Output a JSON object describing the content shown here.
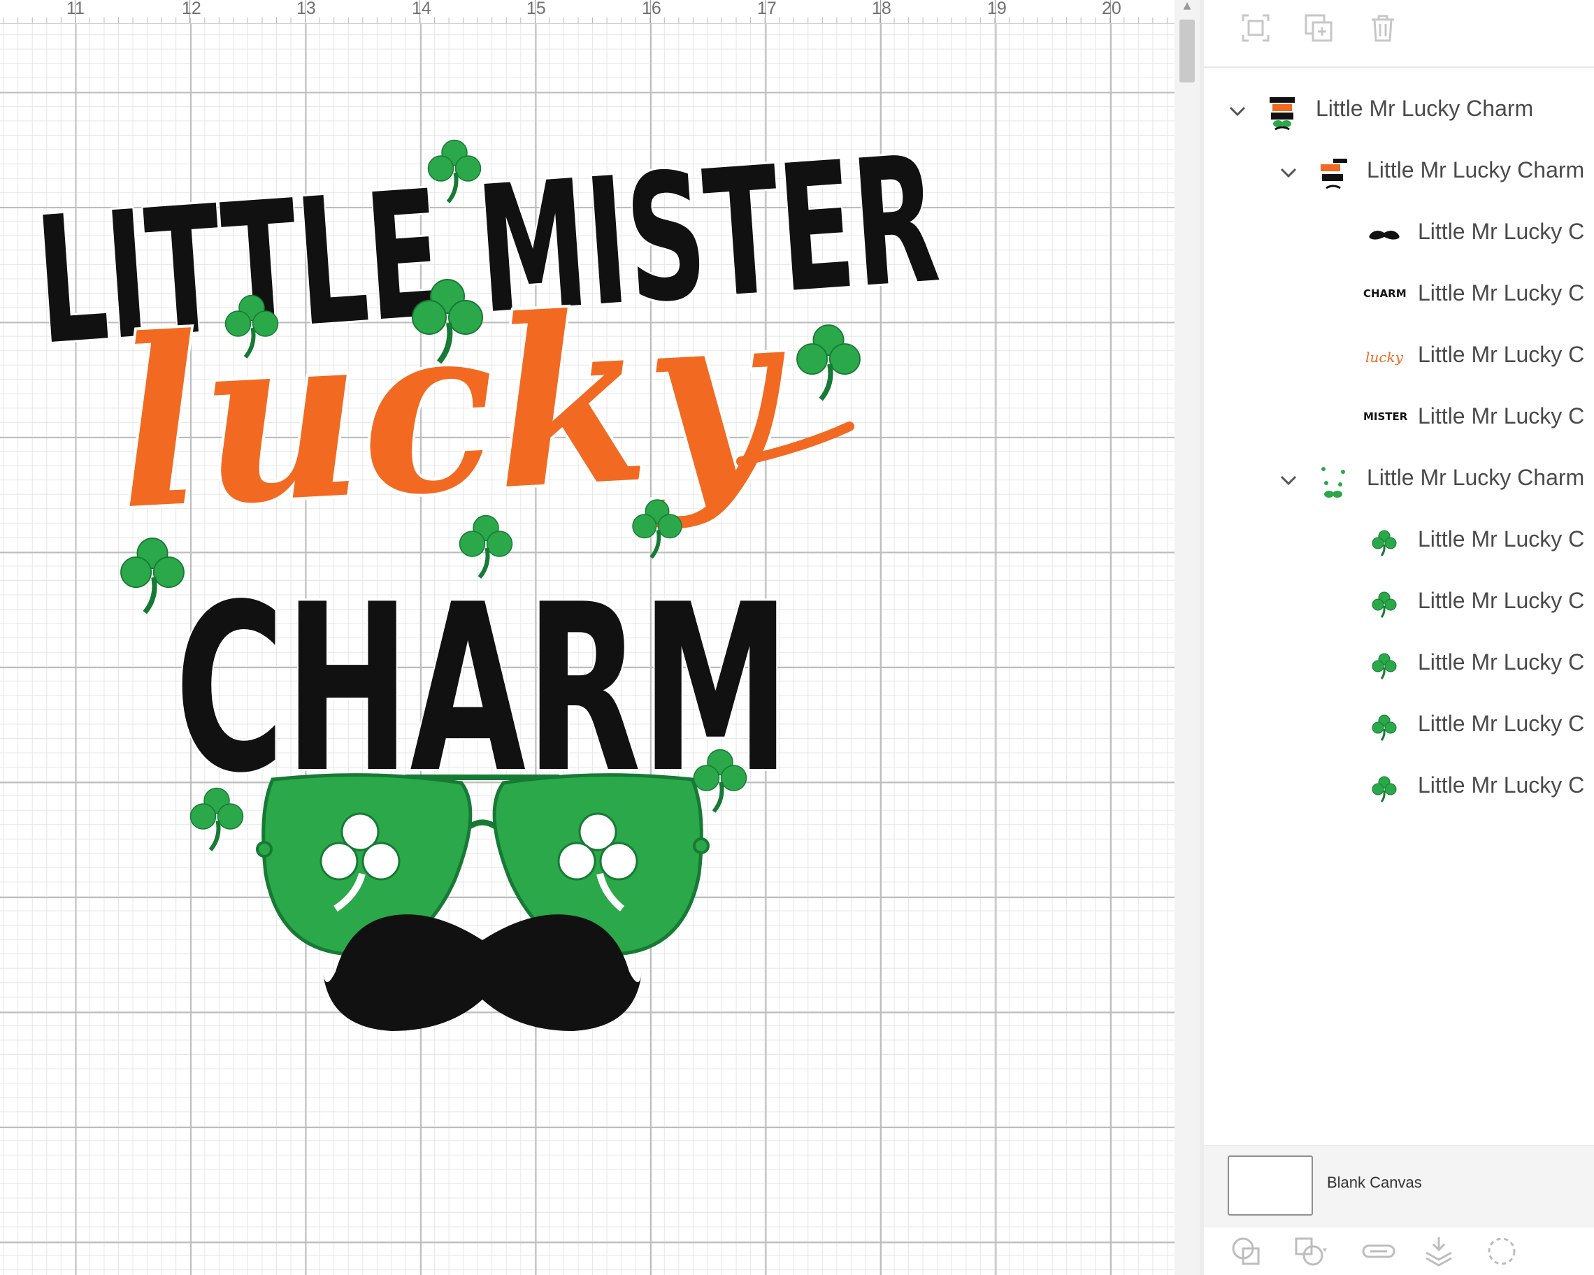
{
  "ruler": {
    "ticks": [
      "11",
      "12",
      "13",
      "14",
      "15",
      "16",
      "17",
      "18",
      "19",
      "20"
    ]
  },
  "design": {
    "line1": "LITTLE MISTER",
    "line2": "lucky",
    "line3": "CHARM",
    "colors": {
      "black": "#111111",
      "orange": "#f26a21",
      "green": "#2aa84a",
      "dark_green": "#177a34"
    }
  },
  "layers": {
    "rows": [
      {
        "label": "Little Mr Lucky Charm",
        "thumb": "full-design-thumb",
        "level": 0,
        "expanded": true
      },
      {
        "label": "Little Mr Lucky Charm",
        "thumb": "text-group-thumb",
        "level": 1,
        "expanded": true
      },
      {
        "label": "Little Mr Lucky C",
        "thumb": "mustache-thumb",
        "level": 2
      },
      {
        "label": "Little Mr Lucky C",
        "thumb": "charm-thumb",
        "level": 2,
        "thumb_text": "CHARM"
      },
      {
        "label": "Little Mr Lucky C",
        "thumb": "lucky-thumb",
        "level": 2,
        "thumb_text": "lucky"
      },
      {
        "label": "Little Mr Lucky C",
        "thumb": "mister-thumb",
        "level": 2,
        "thumb_text": "MISTER"
      },
      {
        "label": "Little Mr Lucky Charm",
        "thumb": "shamrock-group-thumb",
        "level": 1,
        "expanded": true
      },
      {
        "label": "Little Mr Lucky C",
        "thumb": "shamrock-thumb",
        "level": 2
      },
      {
        "label": "Little Mr Lucky C",
        "thumb": "shamrock-thumb",
        "level": 2
      },
      {
        "label": "Little Mr Lucky C",
        "thumb": "shamrock-thumb",
        "level": 2
      },
      {
        "label": "Little Mr Lucky C",
        "thumb": "shamrock-thumb",
        "level": 2
      },
      {
        "label": "Little Mr Lucky C",
        "thumb": "shamrock-thumb",
        "level": 2
      }
    ],
    "blank_canvas_label": "Blank Canvas"
  },
  "toolbar_top": [
    "group-icon",
    "duplicate-icon",
    "delete-icon"
  ],
  "toolbar_bottom": [
    "slice-icon",
    "combine-icon",
    "attach-icon",
    "flatten-icon",
    "contour-icon"
  ]
}
